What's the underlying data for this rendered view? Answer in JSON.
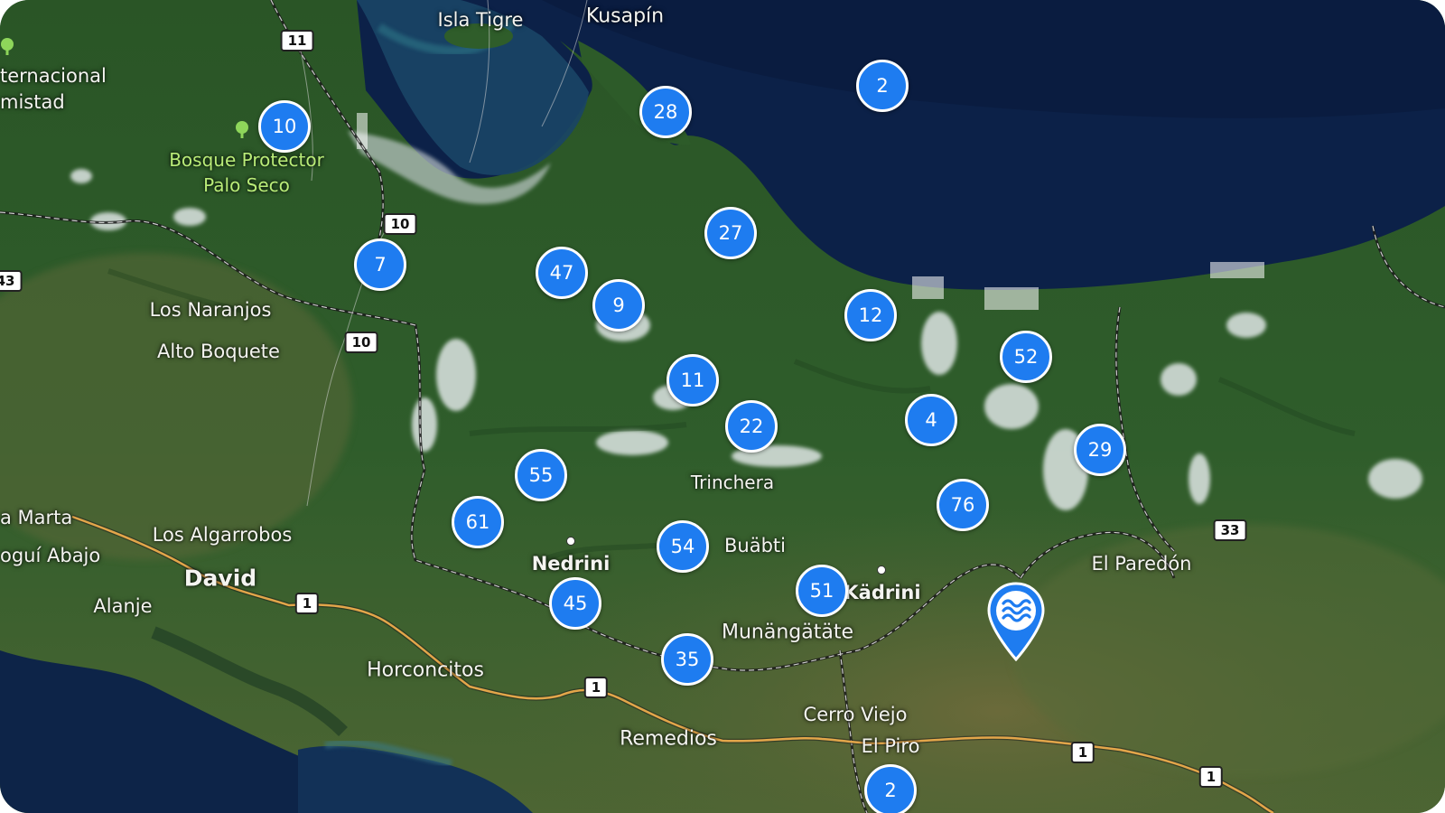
{
  "map": {
    "colors": {
      "sea_deep": "#0c2148",
      "sea_shallow": "#1d4f6c",
      "forest": "#2d5c2a",
      "lowland": "#5a6b3a",
      "road": "#e3a64a",
      "cluster": "#1e7cf0",
      "park_label": "#b9ec78"
    },
    "places": {
      "isla_tigre": "Isla Tigre",
      "kusapin": "Kusapín",
      "internacional": "ternacional",
      "amistad": "mistad",
      "bosque_line1": "Bosque Protector",
      "bosque_line2": "Palo Seco",
      "los_naranjos": "Los Naranjos",
      "alto_boquete": "Alto Boquete",
      "trinchera": "Trinchera",
      "santa_marta": "a Marta",
      "los_algarrobos": "Los Algarrobos",
      "bugui_abajo": "oguí Abajo",
      "david": "David",
      "alanje": "Alanje",
      "nedrini": "Nedrini",
      "buabti": "Buäbti",
      "kadrini": "Kädrini",
      "el_paredon": "El Paredón",
      "munangatate": "Munängätäte",
      "horconcitos": "Horconcitos",
      "cerro_viejo": "Cerro Viejo",
      "el_piro": "El Piro",
      "remedios": "Remedios"
    },
    "route_shields": {
      "r11": "11",
      "r10a": "10",
      "r10b": "10",
      "r43": "43",
      "r1a": "1",
      "r1b": "1",
      "r1c": "1",
      "r1d": "1",
      "r33": "33"
    },
    "clusters": {
      "c1": "10",
      "c2": "28",
      "c3": "2",
      "c4": "27",
      "c5": "7",
      "c6": "47",
      "c7": "9",
      "c8": "12",
      "c9": "52",
      "c10": "11",
      "c11": "22",
      "c12": "4",
      "c13": "29",
      "c14": "55",
      "c15": "61",
      "c16": "76",
      "c17": "54",
      "c18": "45",
      "c19": "51",
      "c20": "35",
      "c21": "2"
    },
    "marker_icon": "water-waves-icon"
  }
}
